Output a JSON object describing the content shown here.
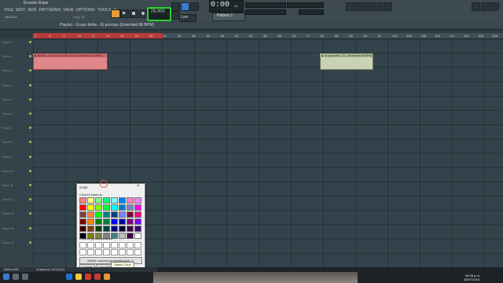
{
  "window": {
    "title": "Ernesto Rojas"
  },
  "menu": {
    "items": [
      "FILE",
      "EDIT",
      "ADD",
      "PATTERNS",
      "VIEW",
      "OPTIONS",
      "TOOLS",
      "?"
    ]
  },
  "hint": {
    "line": "19:13:10",
    "track": "Track 15"
  },
  "transport": {
    "tempo": "78.000",
    "time": "0:00",
    "time_ms": "00"
  },
  "pattern": {
    "label": "Pattern 1"
  },
  "line": {
    "label": "Line"
  },
  "playlist": {
    "title": "Playlist - Grupo limite - El principe (Extended 86 BPM)"
  },
  "ruler": {
    "ticks": [
      "2",
      "5",
      "9",
      "13",
      "17",
      "21",
      "25",
      "29",
      "33",
      "37",
      "41",
      "45",
      "49",
      "53",
      "57",
      "61",
      "65",
      "69",
      "73",
      "77",
      "81",
      "85",
      "89",
      "93",
      "97",
      "101",
      "105",
      "109",
      "113",
      "117",
      "121",
      "125",
      "129"
    ]
  },
  "tracks": [
    "Track 1",
    "Track 2",
    "Track 3",
    "Track 4",
    "Track 5",
    "Track 6",
    "Track 7",
    "Track 8",
    "Track 9",
    "Track 10",
    "Track 11",
    "Track 12",
    "Track 13",
    "Track 14",
    "Track 15"
  ],
  "clips": {
    "red": "▶ Bronco - Que te has vist_ar (Extended fve 78 BPM)",
    "green": "▶ Grupo limite - El... (Extended 86 BPM)"
  },
  "color_dialog": {
    "title": "Color",
    "basic_label": "Colores básicos:",
    "custom_label": "Colores personalizados:",
    "define_label": "Definir colores personalizados >>",
    "ok_label": "Aceptar",
    "cancel_label": "Cancelar",
    "tooltip": "Select Color",
    "basic_colors": [
      "#ff8080",
      "#ffff80",
      "#80ff80",
      "#00ff80",
      "#80ffff",
      "#0080ff",
      "#ff80c0",
      "#ff80ff",
      "#ff0000",
      "#ffff00",
      "#80ff00",
      "#00ff40",
      "#00ffff",
      "#0080c0",
      "#8080c0",
      "#ff00ff",
      "#804040",
      "#ff8040",
      "#00ff00",
      "#008080",
      "#004080",
      "#8080ff",
      "#800040",
      "#ff0080",
      "#800000",
      "#ff8000",
      "#008000",
      "#008040",
      "#0000ff",
      "#0000a0",
      "#800080",
      "#8000ff",
      "#400000",
      "#804000",
      "#004000",
      "#004040",
      "#000080",
      "#000040",
      "#400040",
      "#400080",
      "#000000",
      "#808000",
      "#808040",
      "#808080",
      "#408080",
      "#c0c0c0",
      "#400040",
      "#ffffff"
    ]
  },
  "status": {
    "size": "1680x1050",
    "recording": "Grabando 100/01/11"
  },
  "taskbar": {
    "time": "06:08 p.m.",
    "date": "03/07/2018"
  }
}
